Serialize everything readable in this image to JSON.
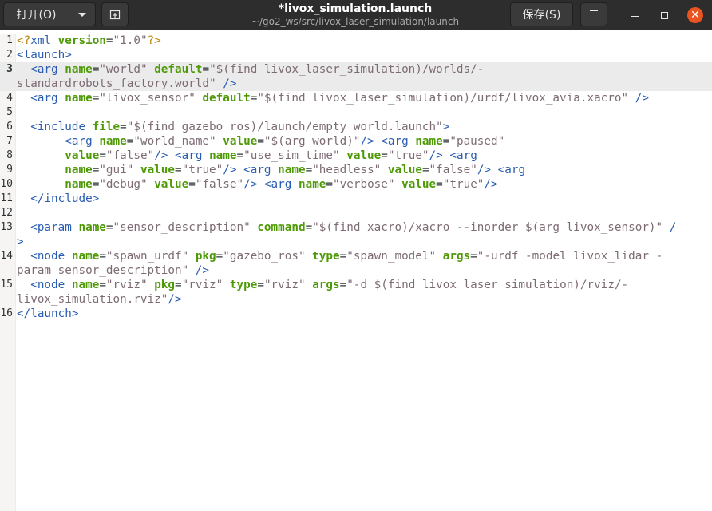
{
  "header": {
    "open_label": "打开(O)",
    "title": "*livox_simulation.launch",
    "subtitle": "~/go2_ws/src/livox_laser_simulation/launch",
    "save_label": "保存(S)",
    "close_glyph": "✕"
  },
  "colors": {
    "tag": "#2a5db0",
    "attribute": "#4e9a06",
    "string": "#7d6b74",
    "processing_instruction": "#b8860b",
    "close_button": "#e95420"
  },
  "icons": {
    "dropdown": "chevron-down-icon",
    "new_tab": "new-tab-icon",
    "menu": "hamburger-menu-icon",
    "minimize": "minimize-icon",
    "maximize": "maximize-icon",
    "close": "close-icon"
  },
  "editor": {
    "current_line": 3,
    "lines": [
      {
        "n": "1",
        "parts": [
          [
            "pi",
            "<?"
          ],
          [
            "tg",
            "xml"
          ],
          [
            "tx",
            " "
          ],
          [
            "at",
            "version"
          ],
          [
            "tx",
            "="
          ],
          [
            "st",
            "\"1.0\""
          ],
          [
            "pi",
            "?>"
          ]
        ]
      },
      {
        "n": "2",
        "parts": [
          [
            "tg",
            "<launch>"
          ]
        ]
      },
      {
        "n": "3",
        "parts": [
          [
            "tx",
            "  "
          ],
          [
            "tg",
            "<arg"
          ],
          [
            "tx",
            " "
          ],
          [
            "at",
            "name"
          ],
          [
            "tx",
            "="
          ],
          [
            "st",
            "\"world\""
          ],
          [
            "tx",
            " "
          ],
          [
            "at",
            "default"
          ],
          [
            "tx",
            "="
          ],
          [
            "st",
            "\"$(find livox_laser_simulation)/worlds/-"
          ]
        ]
      },
      {
        "n": "",
        "parts": [
          [
            "st",
            "standardrobots_factory.world\""
          ],
          [
            "tx",
            " "
          ],
          [
            "tg",
            "/>"
          ]
        ]
      },
      {
        "n": "4",
        "parts": [
          [
            "tx",
            "  "
          ],
          [
            "tg",
            "<arg"
          ],
          [
            "tx",
            " "
          ],
          [
            "at",
            "name"
          ],
          [
            "tx",
            "="
          ],
          [
            "st",
            "\"livox_sensor\""
          ],
          [
            "tx",
            " "
          ],
          [
            "at",
            "default"
          ],
          [
            "tx",
            "="
          ],
          [
            "st",
            "\"$(find livox_laser_simulation)/urdf/livox_avia.xacro\""
          ],
          [
            "tx",
            " "
          ],
          [
            "tg",
            "/>"
          ]
        ]
      },
      {
        "n": "5",
        "parts": []
      },
      {
        "n": "6",
        "parts": [
          [
            "tx",
            "  "
          ],
          [
            "tg",
            "<include"
          ],
          [
            "tx",
            " "
          ],
          [
            "at",
            "file"
          ],
          [
            "tx",
            "="
          ],
          [
            "st",
            "\"$(find gazebo_ros)/launch/empty_world.launch\""
          ],
          [
            "tg",
            ">"
          ]
        ]
      },
      {
        "n": "7",
        "parts": [
          [
            "tx",
            "       "
          ],
          [
            "tg",
            "<arg"
          ],
          [
            "tx",
            " "
          ],
          [
            "at",
            "name"
          ],
          [
            "tx",
            "="
          ],
          [
            "st",
            "\"world_name\""
          ],
          [
            "tx",
            " "
          ],
          [
            "at",
            "value"
          ],
          [
            "tx",
            "="
          ],
          [
            "st",
            "\"$(arg world)\""
          ],
          [
            "tg",
            "/>"
          ],
          [
            "tx",
            " "
          ],
          [
            "tg",
            "<arg"
          ],
          [
            "tx",
            " "
          ],
          [
            "at",
            "name"
          ],
          [
            "tx",
            "="
          ],
          [
            "st",
            "\"paused\""
          ]
        ]
      },
      {
        "n": "8",
        "parts": [
          [
            "tx",
            "       "
          ],
          [
            "at",
            "value"
          ],
          [
            "tx",
            "="
          ],
          [
            "st",
            "\"false\""
          ],
          [
            "tg",
            "/>"
          ],
          [
            "tx",
            " "
          ],
          [
            "tg",
            "<arg"
          ],
          [
            "tx",
            " "
          ],
          [
            "at",
            "name"
          ],
          [
            "tx",
            "="
          ],
          [
            "st",
            "\"use_sim_time\""
          ],
          [
            "tx",
            " "
          ],
          [
            "at",
            "value"
          ],
          [
            "tx",
            "="
          ],
          [
            "st",
            "\"true\""
          ],
          [
            "tg",
            "/>"
          ],
          [
            "tx",
            " "
          ],
          [
            "tg",
            "<arg"
          ]
        ]
      },
      {
        "n": "9",
        "parts": [
          [
            "tx",
            "       "
          ],
          [
            "at",
            "name"
          ],
          [
            "tx",
            "="
          ],
          [
            "st",
            "\"gui\""
          ],
          [
            "tx",
            " "
          ],
          [
            "at",
            "value"
          ],
          [
            "tx",
            "="
          ],
          [
            "st",
            "\"true\""
          ],
          [
            "tg",
            "/>"
          ],
          [
            "tx",
            " "
          ],
          [
            "tg",
            "<arg"
          ],
          [
            "tx",
            " "
          ],
          [
            "at",
            "name"
          ],
          [
            "tx",
            "="
          ],
          [
            "st",
            "\"headless\""
          ],
          [
            "tx",
            " "
          ],
          [
            "at",
            "value"
          ],
          [
            "tx",
            "="
          ],
          [
            "st",
            "\"false\""
          ],
          [
            "tg",
            "/>"
          ],
          [
            "tx",
            " "
          ],
          [
            "tg",
            "<arg"
          ]
        ]
      },
      {
        "n": "10",
        "parts": [
          [
            "tx",
            "       "
          ],
          [
            "at",
            "name"
          ],
          [
            "tx",
            "="
          ],
          [
            "st",
            "\"debug\""
          ],
          [
            "tx",
            " "
          ],
          [
            "at",
            "value"
          ],
          [
            "tx",
            "="
          ],
          [
            "st",
            "\"false\""
          ],
          [
            "tg",
            "/>"
          ],
          [
            "tx",
            " "
          ],
          [
            "tg",
            "<arg"
          ],
          [
            "tx",
            " "
          ],
          [
            "at",
            "name"
          ],
          [
            "tx",
            "="
          ],
          [
            "st",
            "\"verbose\""
          ],
          [
            "tx",
            " "
          ],
          [
            "at",
            "value"
          ],
          [
            "tx",
            "="
          ],
          [
            "st",
            "\"true\""
          ],
          [
            "tg",
            "/>"
          ]
        ]
      },
      {
        "n": "11",
        "parts": [
          [
            "tx",
            "  "
          ],
          [
            "tg",
            "</include>"
          ]
        ]
      },
      {
        "n": "12",
        "parts": []
      },
      {
        "n": "13",
        "parts": [
          [
            "tx",
            "  "
          ],
          [
            "tg",
            "<param"
          ],
          [
            "tx",
            " "
          ],
          [
            "at",
            "name"
          ],
          [
            "tx",
            "="
          ],
          [
            "st",
            "\"sensor_description\""
          ],
          [
            "tx",
            " "
          ],
          [
            "at",
            "command"
          ],
          [
            "tx",
            "="
          ],
          [
            "st",
            "\"$(find xacro)/xacro --inorder $(arg livox_sensor)\""
          ],
          [
            "tx",
            " "
          ],
          [
            "tg",
            "/"
          ]
        ]
      },
      {
        "n": "",
        "parts": [
          [
            "tg",
            ">"
          ]
        ]
      },
      {
        "n": "14",
        "parts": [
          [
            "tx",
            "  "
          ],
          [
            "tg",
            "<node"
          ],
          [
            "tx",
            " "
          ],
          [
            "at",
            "name"
          ],
          [
            "tx",
            "="
          ],
          [
            "st",
            "\"spawn_urdf\""
          ],
          [
            "tx",
            " "
          ],
          [
            "at",
            "pkg"
          ],
          [
            "tx",
            "="
          ],
          [
            "st",
            "\"gazebo_ros\""
          ],
          [
            "tx",
            " "
          ],
          [
            "at",
            "type"
          ],
          [
            "tx",
            "="
          ],
          [
            "st",
            "\"spawn_model\""
          ],
          [
            "tx",
            " "
          ],
          [
            "at",
            "args"
          ],
          [
            "tx",
            "="
          ],
          [
            "st",
            "\"-urdf -model livox_lidar -"
          ]
        ]
      },
      {
        "n": "",
        "parts": [
          [
            "st",
            "param sensor_description\""
          ],
          [
            "tx",
            " "
          ],
          [
            "tg",
            "/>"
          ]
        ]
      },
      {
        "n": "15",
        "parts": [
          [
            "tx",
            "  "
          ],
          [
            "tg",
            "<node"
          ],
          [
            "tx",
            " "
          ],
          [
            "at",
            "name"
          ],
          [
            "tx",
            "="
          ],
          [
            "st",
            "\"rviz\""
          ],
          [
            "tx",
            " "
          ],
          [
            "at",
            "pkg"
          ],
          [
            "tx",
            "="
          ],
          [
            "st",
            "\"rviz\""
          ],
          [
            "tx",
            " "
          ],
          [
            "at",
            "type"
          ],
          [
            "tx",
            "="
          ],
          [
            "st",
            "\"rviz\""
          ],
          [
            "tx",
            " "
          ],
          [
            "at",
            "args"
          ],
          [
            "tx",
            "="
          ],
          [
            "st",
            "\"-d $(find livox_laser_simulation)/rviz/-"
          ]
        ]
      },
      {
        "n": "",
        "parts": [
          [
            "st",
            "livox_simulation.rviz\""
          ],
          [
            "tg",
            "/>"
          ]
        ]
      },
      {
        "n": "16",
        "parts": [
          [
            "tg",
            "</launch>"
          ]
        ]
      }
    ]
  }
}
